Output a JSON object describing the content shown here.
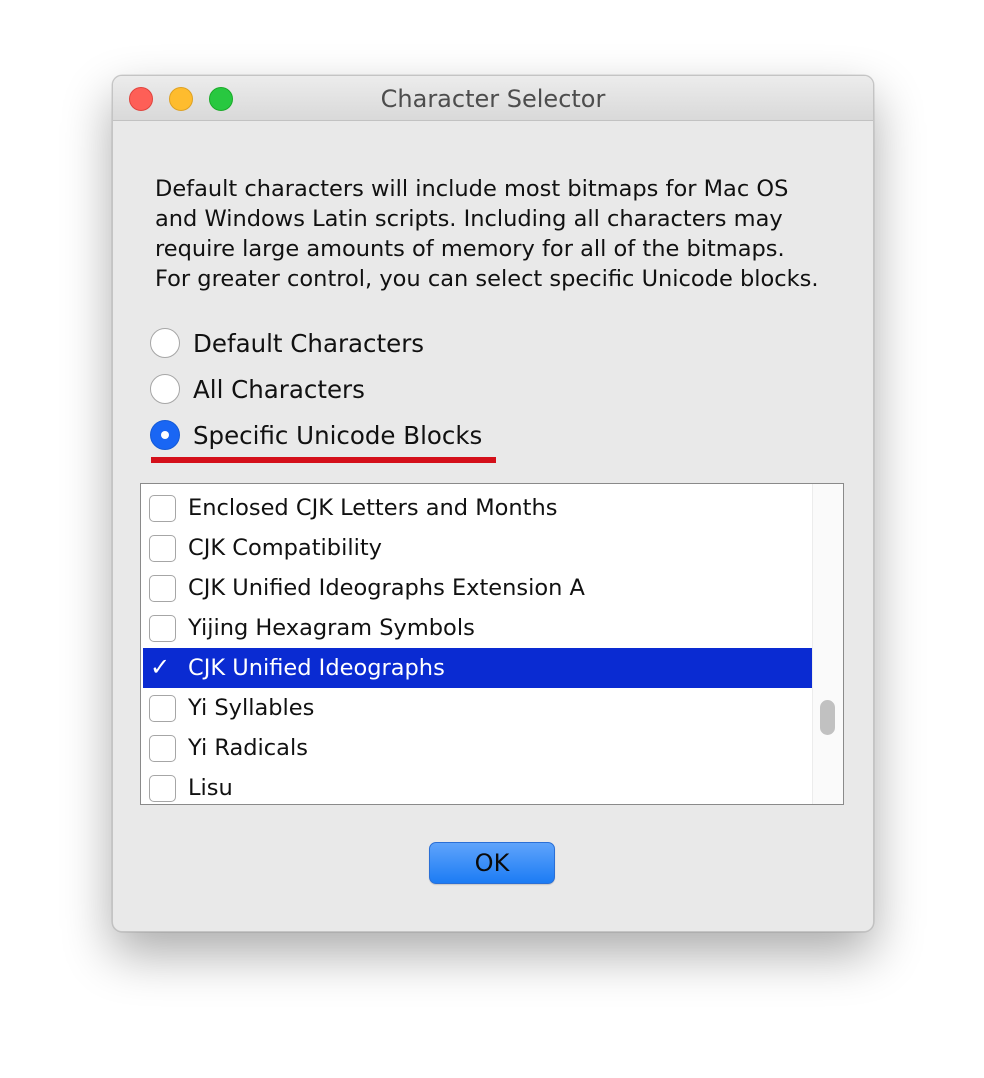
{
  "window": {
    "title": "Character Selector"
  },
  "description": {
    "lines": [
      "Default characters will include most bitmaps for Mac OS",
      "and Windows Latin scripts. Including all characters may",
      "require large amounts of memory for all of the bitmaps.",
      "For greater control, you can select specific Unicode blocks."
    ]
  },
  "radio_options": [
    {
      "label": "Default Characters",
      "selected": false
    },
    {
      "label": "All Characters",
      "selected": false
    },
    {
      "label": "Specific Unicode Blocks",
      "selected": true
    }
  ],
  "unicode_blocks": {
    "items": [
      {
        "label": "Enclosed CJK Letters and Months",
        "checked": false,
        "selected": false
      },
      {
        "label": "CJK Compatibility",
        "checked": false,
        "selected": false
      },
      {
        "label": "CJK Unified Ideographs Extension A",
        "checked": false,
        "selected": false
      },
      {
        "label": "Yijing Hexagram Symbols",
        "checked": false,
        "selected": false
      },
      {
        "label": "CJK Unified Ideographs",
        "checked": true,
        "selected": true
      },
      {
        "label": "Yi Syllables",
        "checked": false,
        "selected": false
      },
      {
        "label": "Yi Radicals",
        "checked": false,
        "selected": false
      },
      {
        "label": "Lisu",
        "checked": false,
        "selected": false
      }
    ],
    "check_glyph": "✓"
  },
  "buttons": {
    "ok_label": "OK"
  },
  "colors": {
    "selection": "#0a2bd2",
    "radio_accent": "#1966f4",
    "annotation_underline": "#d4101a",
    "ok_button": "#1c7cf4"
  }
}
